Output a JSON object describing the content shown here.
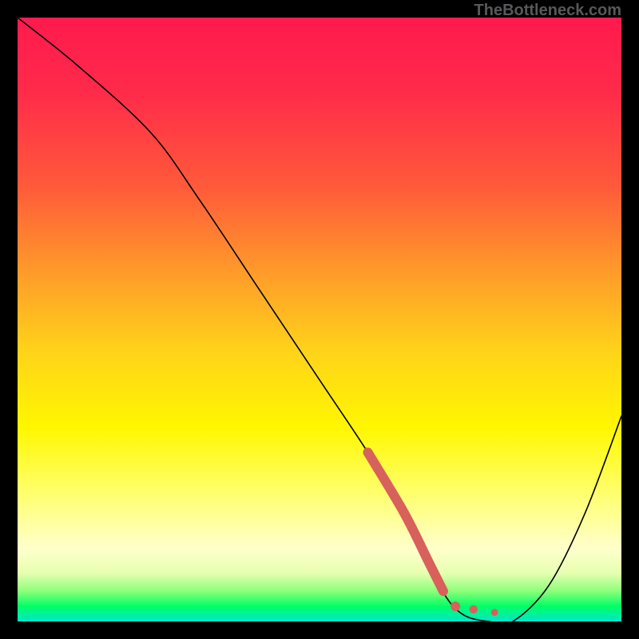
{
  "watermark": "TheBottleneck.com",
  "chart_data": {
    "type": "line",
    "title": "",
    "xlabel": "",
    "ylabel": "",
    "xlim": [
      0,
      100
    ],
    "ylim": [
      0,
      100
    ],
    "series": [
      {
        "name": "curve",
        "x": [
          0,
          10,
          22,
          30,
          40,
          50,
          58,
          64,
          68,
          71,
          74,
          78,
          82,
          88,
          94,
          100
        ],
        "y": [
          100,
          92,
          81,
          70,
          55,
          40,
          28,
          18,
          10,
          4,
          1,
          0,
          0,
          6,
          18,
          34
        ]
      }
    ],
    "highlight": {
      "segment": {
        "x": [
          58,
          64,
          68,
          70.5
        ],
        "y": [
          28,
          18,
          10,
          5
        ]
      },
      "dots": [
        {
          "x": 72.5,
          "y": 2.5
        },
        {
          "x": 75.5,
          "y": 2
        },
        {
          "x": 79,
          "y": 1.5
        }
      ]
    },
    "gradient_note": "vertical red→yellow→green heat-map background"
  }
}
